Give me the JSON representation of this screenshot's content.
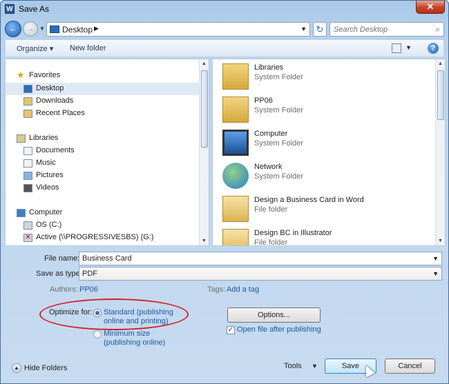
{
  "window": {
    "title": "Save As",
    "app_icon": "W"
  },
  "titlebar": {
    "close_icon": "close-icon",
    "close_glyph": "✕"
  },
  "navbar": {
    "back_glyph": "←",
    "forward_glyph": "→",
    "address": "Desktop",
    "search_placeholder": "Search Desktop"
  },
  "toolbar": {
    "organize": "Organize ▾",
    "new_folder": "New folder",
    "help_glyph": "?"
  },
  "nav_pane": {
    "items": [
      {
        "label": "Favorites",
        "icon": "star-icon"
      },
      {
        "label": "Desktop",
        "icon": "desktop-icon"
      },
      {
        "label": "Downloads",
        "icon": "downloads-icon"
      },
      {
        "label": "Recent Places",
        "icon": "recent-places-icon"
      },
      {
        "label": "Libraries",
        "icon": "libraries-icon"
      },
      {
        "label": "Documents",
        "icon": "documents-icon"
      },
      {
        "label": "Music",
        "icon": "music-icon"
      },
      {
        "label": "Pictures",
        "icon": "pictures-icon"
      },
      {
        "label": "Videos",
        "icon": "videos-icon"
      },
      {
        "label": "Computer",
        "icon": "computer-icon"
      },
      {
        "label": "OS (C:)",
        "icon": "drive-icon"
      },
      {
        "label": "Active (\\\\PROGRESSIVESBS) (G:)",
        "icon": "network-drive-icon"
      }
    ]
  },
  "files": [
    {
      "name": "Libraries",
      "type": "System Folder",
      "icon": "libraries-folder-icon"
    },
    {
      "name": "PP06",
      "type": "System Folder",
      "icon": "user-folder-icon"
    },
    {
      "name": "Computer",
      "type": "System Folder",
      "icon": "computer-icon"
    },
    {
      "name": "Network",
      "type": "System Folder",
      "icon": "network-icon"
    },
    {
      "name": "Design a Business Card in Word",
      "type": "File folder",
      "icon": "folder-icon"
    },
    {
      "name": "Design BC in Illustrator",
      "type": "File folder",
      "icon": "folder-icon"
    }
  ],
  "form": {
    "file_name_label": "File name:",
    "file_name_value": "Business Card",
    "save_as_type_label": "Save as type:",
    "save_as_type_value": "PDF",
    "authors_label": "Authors:",
    "authors_value": "PP06",
    "tags_label": "Tags:",
    "tags_value": "Add a tag",
    "optimize_label": "Optimize for:",
    "optimize_standard_line1": "Standard (publishing",
    "optimize_standard_line2": "online and printing)",
    "optimize_minimum_line1": "Minimum size",
    "optimize_minimum_line2": "(publishing online)",
    "optimize_selected": "standard",
    "options_button": "Options...",
    "open_after_label": "Open file after publishing",
    "open_after_checked": true
  },
  "footer": {
    "hide_folders": "Hide Folders",
    "tools": "Tools",
    "save": "Save",
    "cancel": "Cancel"
  },
  "colors": {
    "accent": "#2a6db9",
    "link": "#1c57a5",
    "highlight_ellipse": "#d0222a"
  }
}
